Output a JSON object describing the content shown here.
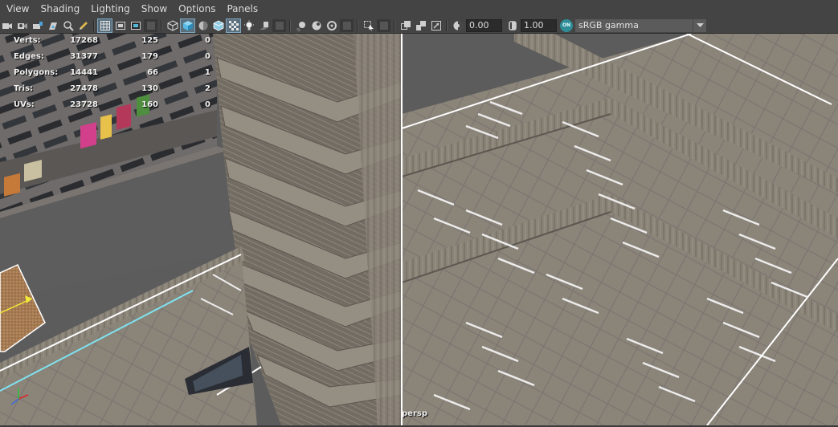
{
  "menu": {
    "items": [
      "View",
      "Shading",
      "Lighting",
      "Show",
      "Options",
      "Panels"
    ]
  },
  "toolbar": {
    "exposure_value": "0.00",
    "gamma_value": "1.00",
    "color_management_badge": "ON",
    "color_space_selected": "sRGB gamma",
    "icons": [
      "camera-select-icon",
      "camera-attributes-icon",
      "bookmarks-icon",
      "image-plane-icon",
      "2d-pan-zoom-icon",
      "grease-pencil-icon",
      "grid-icon",
      "film-gate-icon",
      "resolution-gate-icon",
      "gate-mask-icon",
      "field-chart-icon",
      "safe-action-icon",
      "safe-title-icon",
      "wireframe-icon",
      "smooth-shade-all-icon",
      "default-material-icon",
      "wireframe-on-shaded-icon",
      "textured-icon",
      "use-all-lights-icon",
      "shadows-icon",
      "screen-space-ao-icon",
      "motion-blur-icon",
      "multisample-aa-icon",
      "depth-of-field-icon",
      "isolate-select-icon",
      "xray-icon",
      "xray-active-components-icon",
      "xray-joints-icon",
      "exposure-icon",
      "gamma-icon",
      "color-management-icon"
    ]
  },
  "hud": {
    "rows": [
      {
        "label": "Verts:",
        "scene": "17268",
        "selected": "125",
        "uv": "0"
      },
      {
        "label": "Edges:",
        "scene": "31377",
        "selected": "179",
        "uv": "0"
      },
      {
        "label": "Polygons:",
        "scene": "14441",
        "selected": "66",
        "uv": "1"
      },
      {
        "label": "Tris:",
        "scene": "27478",
        "selected": "130",
        "uv": "2"
      },
      {
        "label": "UVs:",
        "scene": "23728",
        "selected": "160",
        "uv": "0"
      }
    ]
  },
  "viewport": {
    "camera_name": "persp"
  },
  "colors": {
    "ui_background": "#444444",
    "active_toggle": "#5a6f7e",
    "color_management_accent": "#2f8d98",
    "concrete": "#8a8278",
    "parking_line": "#e8e8e8",
    "selection_wire": "#ffffff",
    "axis_x": "#d9262b",
    "axis_y": "#2fbf3a",
    "axis_z": "#3b6cd9"
  }
}
